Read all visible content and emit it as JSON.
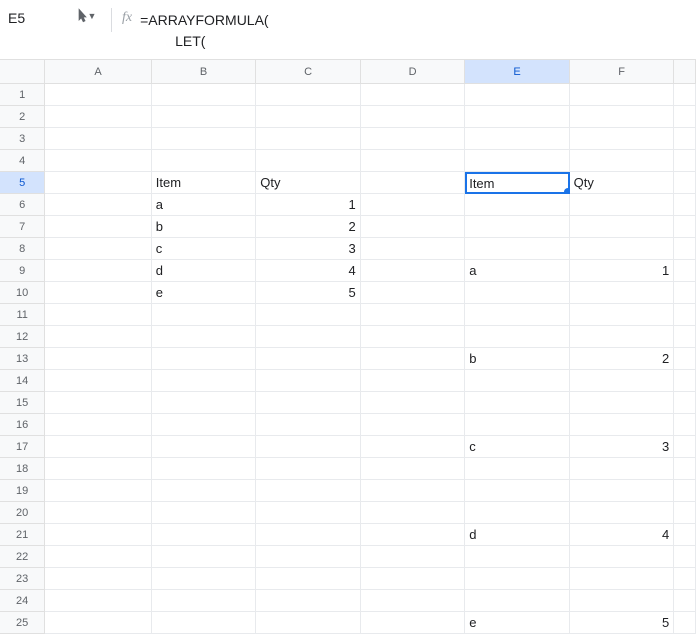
{
  "formula_bar": {
    "cell_ref": "E5",
    "formula_line1": "=ARRAYFORMULA(",
    "formula_line2": "         LET("
  },
  "columns": [
    "A",
    "B",
    "C",
    "D",
    "E",
    "F"
  ],
  "selected_col": "E",
  "selected_row": 5,
  "row_count": 25,
  "cells": {
    "B5": "Item",
    "C5": "Qty",
    "B6": "a",
    "C6": "1",
    "B7": "b",
    "C7": "2",
    "B8": "c",
    "C8": "3",
    "B9": "d",
    "C9": "4",
    "B10": "e",
    "C10": "5",
    "E5": "Item",
    "F5": "Qty",
    "E9": "a",
    "F9": "1",
    "E13": "b",
    "F13": "2",
    "E17": "c",
    "F17": "3",
    "E21": "d",
    "F21": "4",
    "E25": "e",
    "F25": "5"
  },
  "numeric_cols": [
    "C",
    "F"
  ],
  "chart_data": {
    "type": "table",
    "tables": [
      {
        "headers": [
          "Item",
          "Qty"
        ],
        "rows": [
          [
            "a",
            1
          ],
          [
            "b",
            2
          ],
          [
            "c",
            3
          ],
          [
            "d",
            4
          ],
          [
            "e",
            5
          ]
        ]
      },
      {
        "headers": [
          "Item",
          "Qty"
        ],
        "rows": [
          [
            "a",
            1
          ],
          [
            "b",
            2
          ],
          [
            "c",
            3
          ],
          [
            "d",
            4
          ],
          [
            "e",
            5
          ]
        ]
      }
    ]
  }
}
